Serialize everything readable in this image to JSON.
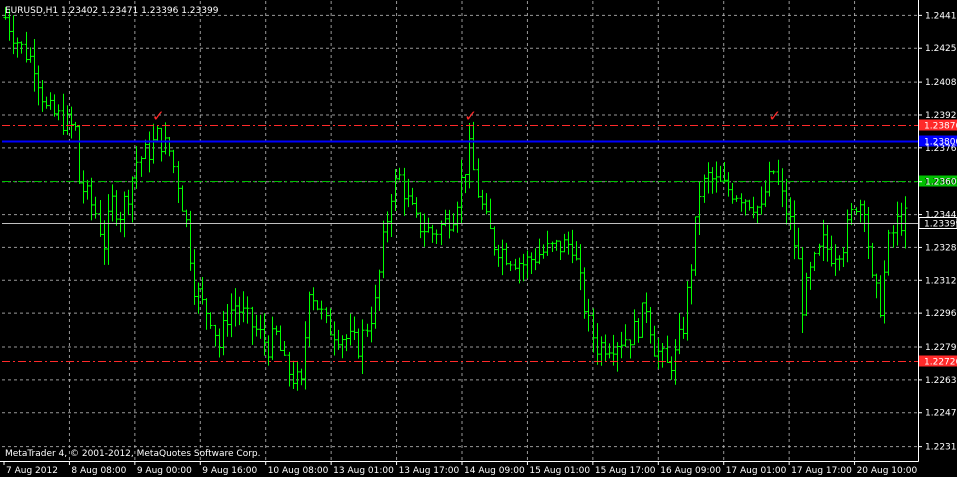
{
  "header": {
    "text": "EURUSD,H1  1.23402 1.23471 1.23396 1.23399"
  },
  "footer": {
    "copyright": "MetaTrader 4, © 2001-2012, MetaQuotes Software Corp."
  },
  "chart_data": {
    "type": "bar",
    "symbol": "EURUSD",
    "timeframe": "H1",
    "grid": true,
    "colors": {
      "background": "#000000",
      "bars": "#00ff00",
      "grid": "#c0c0c0",
      "axis": "#ffffff",
      "resistance": "#ff2a2a",
      "blue_line": "#0000ff",
      "green_line": "#00c000",
      "bid_line": "#c0c0c0",
      "marker": "#ff2a2a"
    },
    "ylim": [
      1.2224,
      1.2448
    ],
    "y_ticks": [
      "1.24410",
      "1.24250",
      "1.24085",
      "1.23925",
      "1.23765",
      "1.23600",
      "1.23440",
      "1.23280",
      "1.23120",
      "1.22960",
      "1.22795",
      "1.22635",
      "1.22475",
      "1.22310"
    ],
    "x_ticks": [
      "7 Aug 2012",
      "8 Aug 08:00",
      "9 Aug 00:00",
      "9 Aug 16:00",
      "10 Aug 08:00",
      "13 Aug 01:00",
      "13 Aug 17:00",
      "14 Aug 09:00",
      "15 Aug 01:00",
      "15 Aug 17:00",
      "16 Aug 09:00",
      "17 Aug 01:00",
      "17 Aug 17:00",
      "20 Aug 10:00"
    ],
    "levels": [
      {
        "name": "resistance",
        "value": 1.23875,
        "label": "1.23876",
        "style": "dashdot",
        "color": "#ff2a2a"
      },
      {
        "name": "blue",
        "value": 1.238,
        "label": "1.23800",
        "style": "solid",
        "color": "#0000ff"
      },
      {
        "name": "green",
        "value": 1.23603,
        "label": "1.23603",
        "style": "dashdot",
        "color": "#00c000"
      },
      {
        "name": "bid",
        "value": 1.23399,
        "label": "1.23399",
        "style": "solid",
        "color": "#c0c0c0"
      },
      {
        "name": "support",
        "value": 1.22726,
        "label": "1.22726",
        "style": "dashdot",
        "color": "#ff2a2a"
      }
    ],
    "markers": [
      {
        "bar": 37,
        "symbol": "✓"
      },
      {
        "bar": 113,
        "symbol": "✓"
      },
      {
        "bar": 187,
        "symbol": "✓"
      }
    ],
    "close_path": [
      [
        0,
        1.244
      ],
      [
        4,
        1.2425
      ],
      [
        7,
        1.2418
      ],
      [
        10,
        1.2395
      ],
      [
        14,
        1.239
      ],
      [
        17,
        1.2385
      ],
      [
        18,
        1.236
      ],
      [
        22,
        1.2345
      ],
      [
        24,
        1.233
      ],
      [
        26,
        1.235
      ],
      [
        28,
        1.2345
      ],
      [
        30,
        1.2355
      ],
      [
        32,
        1.237
      ],
      [
        35,
        1.2375
      ],
      [
        37,
        1.2382
      ],
      [
        40,
        1.2375
      ],
      [
        42,
        1.236
      ],
      [
        44,
        1.234
      ],
      [
        45,
        1.2325
      ],
      [
        46,
        1.231
      ],
      [
        48,
        1.23
      ],
      [
        50,
        1.2295
      ],
      [
        52,
        1.228
      ],
      [
        54,
        1.2295
      ],
      [
        56,
        1.23
      ],
      [
        60,
        1.229
      ],
      [
        64,
        1.228
      ],
      [
        66,
        1.2285
      ],
      [
        68,
        1.227
      ],
      [
        70,
        1.2265
      ],
      [
        72,
        1.226
      ],
      [
        74,
        1.231
      ],
      [
        78,
        1.229
      ],
      [
        82,
        1.2285
      ],
      [
        86,
        1.228
      ],
      [
        88,
        1.229
      ],
      [
        90,
        1.23
      ],
      [
        92,
        1.233
      ],
      [
        94,
        1.2355
      ],
      [
        96,
        1.2362
      ],
      [
        98,
        1.235
      ],
      [
        100,
        1.234
      ],
      [
        104,
        1.2335
      ],
      [
        107,
        1.234
      ],
      [
        109,
        1.2345
      ],
      [
        111,
        1.236
      ],
      [
        113,
        1.2375
      ],
      [
        115,
        1.2355
      ],
      [
        117,
        1.234
      ],
      [
        119,
        1.233
      ],
      [
        122,
        1.2325
      ],
      [
        126,
        1.232
      ],
      [
        130,
        1.2325
      ],
      [
        134,
        1.2328
      ],
      [
        138,
        1.233
      ],
      [
        140,
        1.231
      ],
      [
        142,
        1.229
      ],
      [
        144,
        1.228
      ],
      [
        148,
        1.2282
      ],
      [
        152,
        1.2285
      ],
      [
        154,
        1.229
      ],
      [
        156,
        1.23
      ],
      [
        158,
        1.228
      ],
      [
        161,
        1.227
      ],
      [
        163,
        1.2275
      ],
      [
        165,
        1.229
      ],
      [
        167,
        1.232
      ],
      [
        169,
        1.2355
      ],
      [
        171,
        1.2362
      ],
      [
        174,
        1.2358
      ],
      [
        178,
        1.2355
      ],
      [
        182,
        1.235
      ],
      [
        184,
        1.2345
      ],
      [
        185,
        1.2355
      ],
      [
        187,
        1.2365
      ],
      [
        189,
        1.2352
      ],
      [
        191,
        1.234
      ],
      [
        193,
        1.232
      ],
      [
        194,
        1.23
      ],
      [
        196,
        1.2315
      ],
      [
        199,
        1.233
      ],
      [
        201,
        1.2325
      ],
      [
        204,
        1.233
      ],
      [
        207,
        1.235
      ],
      [
        209,
        1.235
      ],
      [
        211,
        1.231
      ],
      [
        213,
        1.23
      ],
      [
        215,
        1.233
      ],
      [
        217,
        1.234
      ],
      [
        219,
        1.2342
      ]
    ],
    "total_bars": 220
  }
}
